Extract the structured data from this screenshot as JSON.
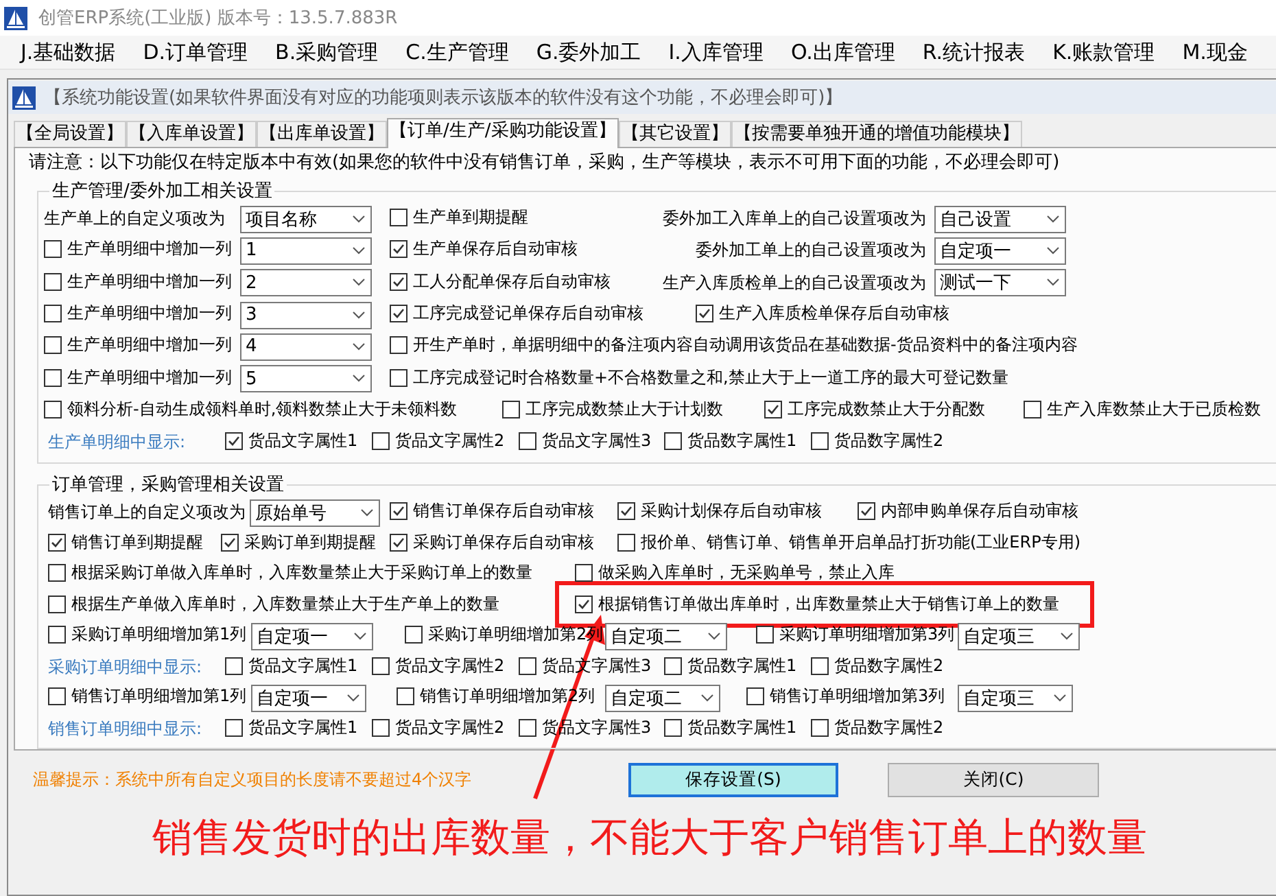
{
  "app_title": "创管ERP系统(工业版) 版本号：13.5.7.883R",
  "menu": [
    "J.基础数据",
    "D.订单管理",
    "B.采购管理",
    "C.生产管理",
    "G.委外加工",
    "I.入库管理",
    "O.出库管理",
    "R.统计报表",
    "K.账款管理",
    "M.现金"
  ],
  "dialog_title": "【系统功能设置(如果软件界面没有对应的功能项则表示该版本的软件没有这个功能，不必理会即可)】",
  "tabs": [
    {
      "label": "【全局设置】",
      "selected": false
    },
    {
      "label": "【入库单设置】",
      "selected": false
    },
    {
      "label": "【出库单设置】",
      "selected": false
    },
    {
      "label": "【订单/生产/采购功能设置】",
      "selected": true
    },
    {
      "label": "【其它设置】",
      "selected": false
    },
    {
      "label": "【按需要单独开通的增值功能模块】",
      "selected": false
    }
  ],
  "notice": "请注意：以下功能仅在特定版本中有效(如果您的软件中没有销售订单，采购，生产等模块，表示不可用下面的功能，不必理会即可)",
  "groups": [
    {
      "title": "生产管理/委外加工相关设置",
      "rows": [
        {
          "items": [
            {
              "kind": "label",
              "text": "生产单上的自定义项改为"
            },
            {
              "kind": "select",
              "value": "项目名称"
            },
            {
              "kind": "check",
              "label": "生产单到期提醒",
              "checked": false
            },
            {
              "kind": "label",
              "text": "委外加工入库单上的自己设置项改为"
            },
            {
              "kind": "select",
              "value": "自己设置"
            }
          ]
        },
        {
          "items": [
            {
              "kind": "check",
              "label": "生产单明细中增加一列",
              "checked": false
            },
            {
              "kind": "select",
              "value": "1"
            },
            {
              "kind": "check",
              "label": "生产单保存后自动审核",
              "checked": true
            },
            {
              "kind": "label",
              "text": "委外加工单上的自己设置项改为"
            },
            {
              "kind": "select",
              "value": "自定项一"
            }
          ]
        },
        {
          "items": [
            {
              "kind": "check",
              "label": "生产单明细中增加一列",
              "checked": false
            },
            {
              "kind": "select",
              "value": "2"
            },
            {
              "kind": "check",
              "label": "工人分配单保存后自动审核",
              "checked": true
            },
            {
              "kind": "label",
              "text": "生产入库质检单上的自己设置项改为"
            },
            {
              "kind": "select",
              "value": "测试一下"
            }
          ]
        },
        {
          "items": [
            {
              "kind": "check",
              "label": "生产单明细中增加一列",
              "checked": false
            },
            {
              "kind": "select",
              "value": "3"
            },
            {
              "kind": "check",
              "label": "工序完成登记单保存后自动审核",
              "checked": true
            },
            {
              "kind": "check",
              "label": "生产入库质检单保存后自动审核",
              "checked": true
            }
          ]
        },
        {
          "items": [
            {
              "kind": "check",
              "label": "生产单明细中增加一列",
              "checked": false
            },
            {
              "kind": "select",
              "value": "4"
            },
            {
              "kind": "check",
              "label": "开生产单时，单据明细中的备注项内容自动调用该货品在基础数据-货品资料中的备注项内容",
              "checked": false
            }
          ]
        },
        {
          "items": [
            {
              "kind": "check",
              "label": "生产单明细中增加一列",
              "checked": false
            },
            {
              "kind": "select",
              "value": "5"
            },
            {
              "kind": "check",
              "label": "工序完成登记时合格数量+不合格数量之和,禁止大于上一道工序的最大可登记数量",
              "checked": false
            }
          ]
        },
        {
          "items": [
            {
              "kind": "check",
              "label": "领料分析-自动生成领料单时,领料数禁止大于未领料数",
              "checked": false
            },
            {
              "kind": "check",
              "label": "工序完成数禁止大于计划数",
              "checked": false
            },
            {
              "kind": "check",
              "label": "工序完成数禁止大于分配数",
              "checked": true
            },
            {
              "kind": "check",
              "label": "生产入库数禁止大于已质检数",
              "checked": false
            }
          ]
        },
        {
          "items": [
            {
              "kind": "caption",
              "text": "生产单明细中显示:"
            },
            {
              "kind": "check",
              "label": "货品文字属性1",
              "checked": true
            },
            {
              "kind": "check",
              "label": "货品文字属性2",
              "checked": false
            },
            {
              "kind": "check",
              "label": "货品文字属性3",
              "checked": false
            },
            {
              "kind": "check",
              "label": "货品数字属性1",
              "checked": false
            },
            {
              "kind": "check",
              "label": "货品数字属性2",
              "checked": false
            }
          ]
        }
      ]
    },
    {
      "title": "订单管理，采购管理相关设置",
      "rows": [
        {
          "items": [
            {
              "kind": "label",
              "text": "销售订单上的自定义项改为"
            },
            {
              "kind": "select",
              "value": "原始单号"
            },
            {
              "kind": "check",
              "label": "销售订单保存后自动审核",
              "checked": true
            },
            {
              "kind": "check",
              "label": "采购计划保存后自动审核",
              "checked": true
            },
            {
              "kind": "check",
              "label": "内部申购单保存后自动审核",
              "checked": true
            }
          ]
        },
        {
          "items": [
            {
              "kind": "check",
              "label": "销售订单到期提醒",
              "checked": true
            },
            {
              "kind": "check",
              "label": "采购订单到期提醒",
              "checked": true
            },
            {
              "kind": "check",
              "label": "采购订单保存后自动审核",
              "checked": true
            },
            {
              "kind": "check",
              "label": "报价单、销售订单、销售单开启单品打折功能(工业ERP专用)",
              "checked": false
            }
          ]
        },
        {
          "items": [
            {
              "kind": "check",
              "label": "根据采购订单做入库单时，入库数量禁止大于采购订单上的数量",
              "checked": false
            },
            {
              "kind": "check",
              "label": "做采购入库单时，无采购单号，禁止入库",
              "checked": false
            }
          ]
        },
        {
          "items": [
            {
              "kind": "check",
              "label": "根据生产单做入库单时，入库数量禁止大于生产单上的数量",
              "checked": false
            },
            {
              "kind": "check",
              "label": "根据销售订单做出库单时，出库数量禁止大于销售订单上的数量",
              "checked": true
            }
          ]
        },
        {
          "items": [
            {
              "kind": "check",
              "label": "采购订单明细增加第1列",
              "checked": false
            },
            {
              "kind": "select",
              "value": "自定项一"
            },
            {
              "kind": "check",
              "label": "采购订单明细增加第2列",
              "checked": false
            },
            {
              "kind": "select",
              "value": "自定项二"
            },
            {
              "kind": "check",
              "label": "采购订单明细增加第3列",
              "checked": false
            },
            {
              "kind": "select",
              "value": "自定项三"
            }
          ]
        },
        {
          "items": [
            {
              "kind": "caption",
              "text": "采购订单明细中显示:"
            },
            {
              "kind": "check",
              "label": "货品文字属性1",
              "checked": false
            },
            {
              "kind": "check",
              "label": "货品文字属性2",
              "checked": false
            },
            {
              "kind": "check",
              "label": "货品文字属性3",
              "checked": false
            },
            {
              "kind": "check",
              "label": "货品数字属性1",
              "checked": false
            },
            {
              "kind": "check",
              "label": "货品数字属性2",
              "checked": false
            }
          ]
        },
        {
          "items": [
            {
              "kind": "check",
              "label": "销售订单明细增加第1列",
              "checked": false
            },
            {
              "kind": "select",
              "value": "自定项一"
            },
            {
              "kind": "check",
              "label": "销售订单明细增加第2列",
              "checked": false
            },
            {
              "kind": "select",
              "value": "自定项二"
            },
            {
              "kind": "check",
              "label": "销售订单明细增加第3列",
              "checked": false
            },
            {
              "kind": "select",
              "value": "自定项三"
            }
          ]
        },
        {
          "items": [
            {
              "kind": "caption",
              "text": "销售订单明细中显示:"
            },
            {
              "kind": "check",
              "label": "货品文字属性1",
              "checked": false
            },
            {
              "kind": "check",
              "label": "货品文字属性2",
              "checked": false
            },
            {
              "kind": "check",
              "label": "货品文字属性3",
              "checked": false
            },
            {
              "kind": "check",
              "label": "货品数字属性1",
              "checked": false
            },
            {
              "kind": "check",
              "label": "货品数字属性2",
              "checked": false
            }
          ]
        }
      ]
    }
  ],
  "tip": "温馨提示：系统中所有自定义项目的长度请不要超过4个汉字",
  "buttons": [
    {
      "label": "保存设置(S)",
      "focused": true
    },
    {
      "label": "关闭(C)",
      "focused": false
    }
  ],
  "annotation": "销售发货时的出库数量，不能大于客户销售订单上的数量"
}
